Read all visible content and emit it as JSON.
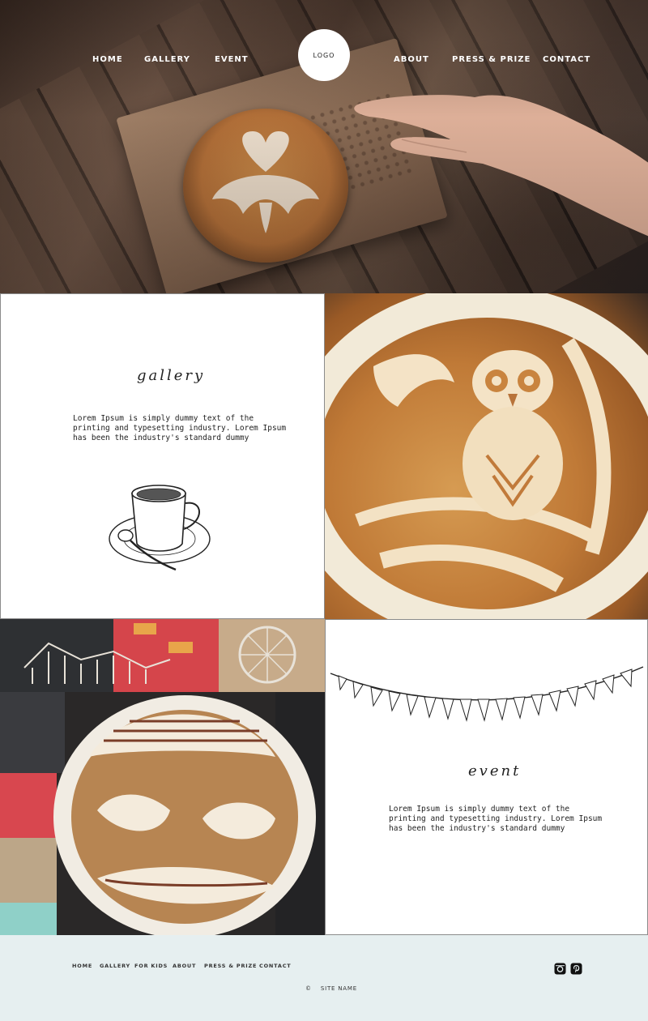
{
  "nav": {
    "home": "HOME",
    "gallery": "GALLERY",
    "event": "EVENT",
    "logo": "LOGO",
    "about": "ABOUT",
    "press": "PRESS & PRIZE",
    "contact": "CONTACT"
  },
  "gallery": {
    "title": "gallery",
    "lines": [
      "Lorem Ipsum is simply dummy text of the",
      "printing and typesetting industry. Lorem Ipsum",
      "has been the industry's standard dummy"
    ]
  },
  "event": {
    "title": "event",
    "lines": [
      "Lorem Ipsum is simply dummy text of the",
      "printing and typesetting industry. Lorem Ipsum",
      "has been the industry's standard dummy"
    ]
  },
  "footer": {
    "links": [
      "HOME",
      "GALLERY",
      "FOR KIDS",
      "ABOUT",
      "PRESS & PRIZE",
      "CONTACT"
    ],
    "copyright_symbol": "©",
    "site_name": "SITE NAME",
    "social_icons": [
      "instagram-icon",
      "pinterest-icon"
    ]
  },
  "colors": {
    "footer_bg": "#e6eff0",
    "nav_text": "#ffffff"
  }
}
